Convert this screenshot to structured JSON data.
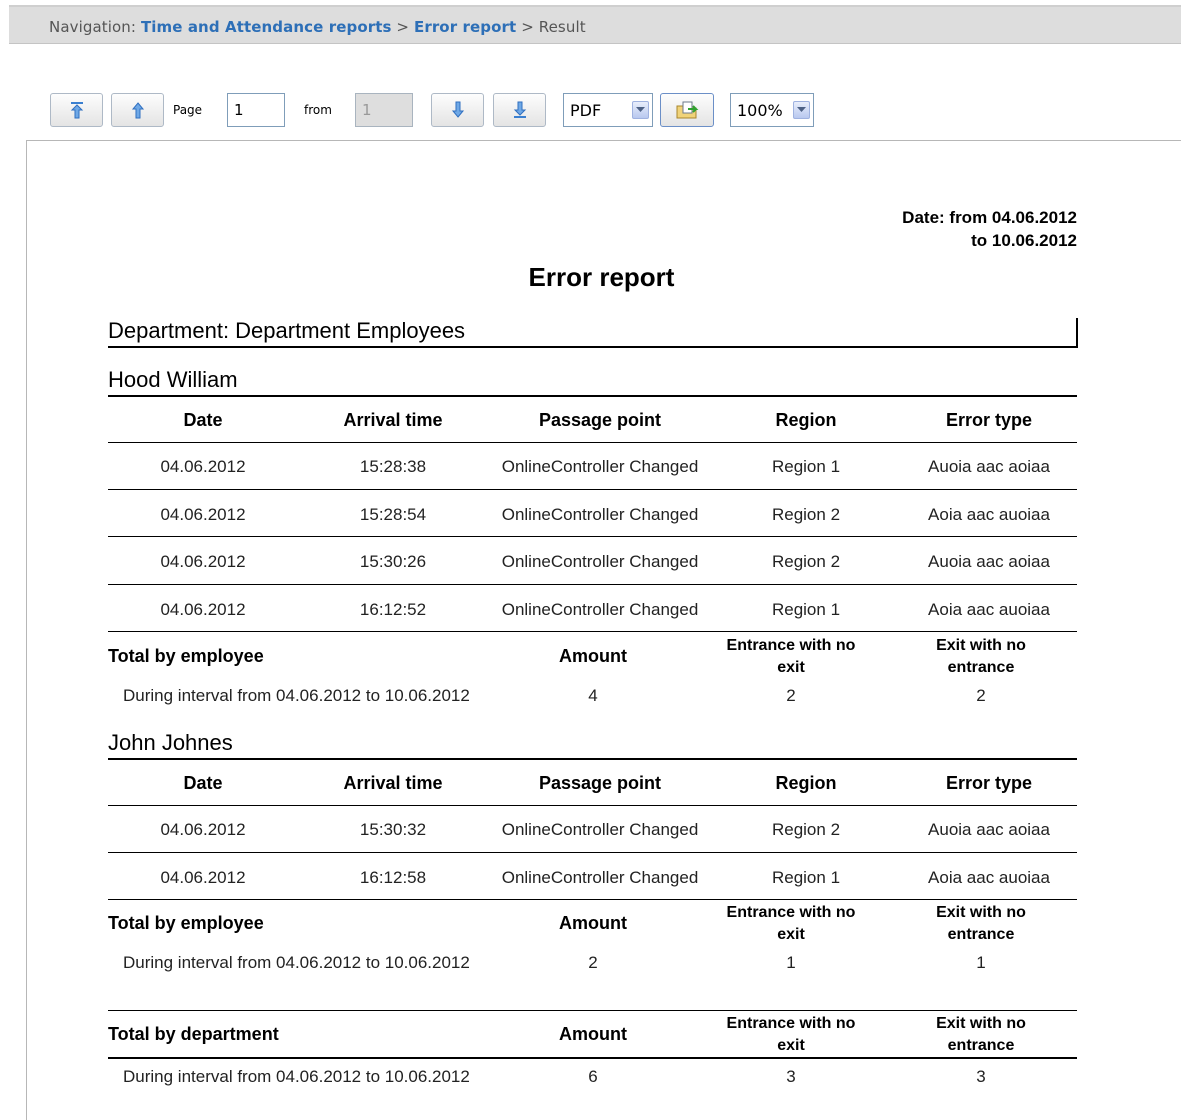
{
  "navigation": {
    "prefix": "Navigation:",
    "crumb1": "Time and Attendance reports",
    "sep1": ">",
    "crumb2": "Error report",
    "sep2": ">",
    "current": "Result"
  },
  "toolbar": {
    "page_label": "Page",
    "page_value": "1",
    "from_label": "from",
    "total_pages": "1",
    "format": "PDF",
    "zoom": "100%"
  },
  "report": {
    "date_line1": "Date: from 04.06.2012",
    "date_line2": "to 10.06.2012",
    "title": "Error report",
    "department": "Department: Department Employees",
    "columns": [
      "Date",
      "Arrival time",
      "Passage point",
      "Region",
      "Error type"
    ],
    "total_by_employee": "Total by employee",
    "total_by_department": "Total by department",
    "summary_columns": [
      "Amount",
      "Entrance with no",
      "exit",
      "Exit with no",
      "entrance"
    ],
    "interval_text": "During interval from 04.06.2012 to 10.06.2012",
    "employees": [
      {
        "name": "Hood William",
        "rows": [
          [
            "04.06.2012",
            "15:28:38",
            "OnlineController Changed",
            "Region 1",
            "Auoia aac aoiaa"
          ],
          [
            "04.06.2012",
            "15:28:54",
            "OnlineController Changed",
            "Region 2",
            "Aoia aac auoiaa"
          ],
          [
            "04.06.2012",
            "15:30:26",
            "OnlineController Changed",
            "Region 2",
            "Auoia aac aoiaa"
          ],
          [
            "04.06.2012",
            "16:12:52",
            "OnlineController Changed",
            "Region 1",
            "Aoia aac auoiaa"
          ]
        ],
        "totals": [
          "4",
          "2",
          "2"
        ]
      },
      {
        "name": "John Johnes",
        "rows": [
          [
            "04.06.2012",
            "15:30:32",
            "OnlineController Changed",
            "Region 2",
            "Auoia aac aoiaa"
          ],
          [
            "04.06.2012",
            "16:12:58",
            "OnlineController Changed",
            "Region 1",
            "Aoia aac auoiaa"
          ]
        ],
        "totals": [
          "2",
          "1",
          "1"
        ]
      }
    ],
    "department_totals": [
      "6",
      "3",
      "3"
    ]
  }
}
